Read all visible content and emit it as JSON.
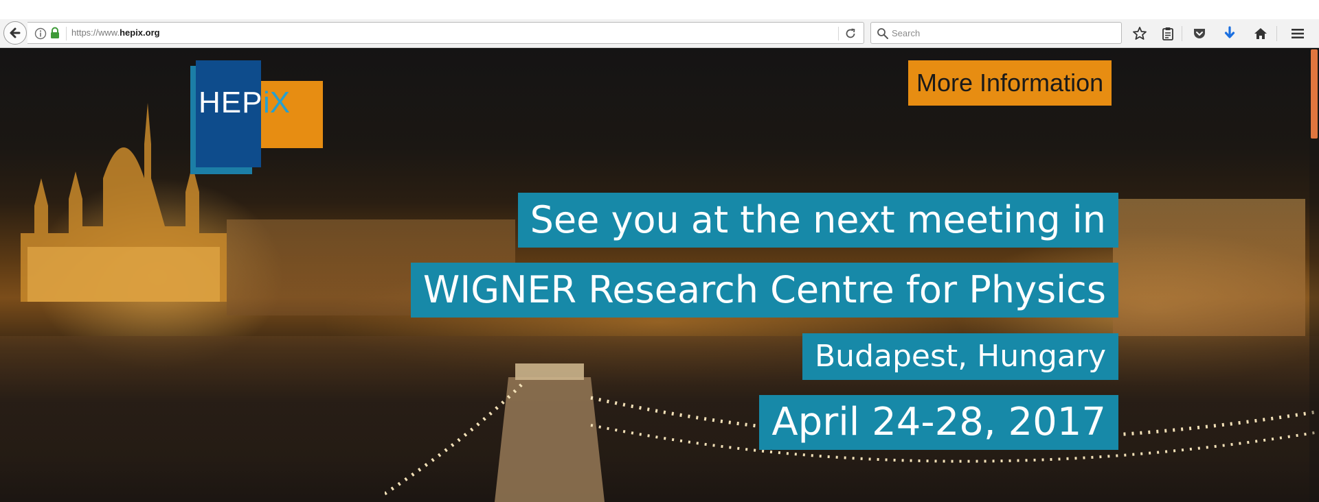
{
  "browser": {
    "url": {
      "prefix": "https://www.",
      "domain": "hepix.org",
      "suffix": ""
    },
    "search": {
      "placeholder": "Search"
    },
    "icons": {
      "back": "arrow-left-icon",
      "info": "info-circle-icon",
      "lock": "lock-icon",
      "reload": "reload-icon",
      "search": "magnifier-icon",
      "bookmark": "star-icon",
      "reading_list": "clipboard-icon",
      "pocket": "pocket-icon",
      "downloads": "arrow-down-icon",
      "home": "home-icon",
      "menu": "hamburger-menu-icon"
    },
    "colors": {
      "lock": "#3d9a37",
      "downloads": "#1a6fe0"
    }
  },
  "page": {
    "logo": {
      "hep": "HEP",
      "ix": "iX"
    },
    "more_info_label": "More Information",
    "hero": {
      "line1": "See you at the next meeting in",
      "line2": "WIGNER Research Centre for Physics",
      "line3": "Budapest, Hungary",
      "line4": "April 24-28, 2017"
    },
    "colors": {
      "hero_bg": "#1789a8",
      "orange": "#e78d12",
      "logo_blue": "#0e4c8c",
      "logo_teal": "#1c7ea6",
      "scrollbar": "#e1763f"
    }
  }
}
